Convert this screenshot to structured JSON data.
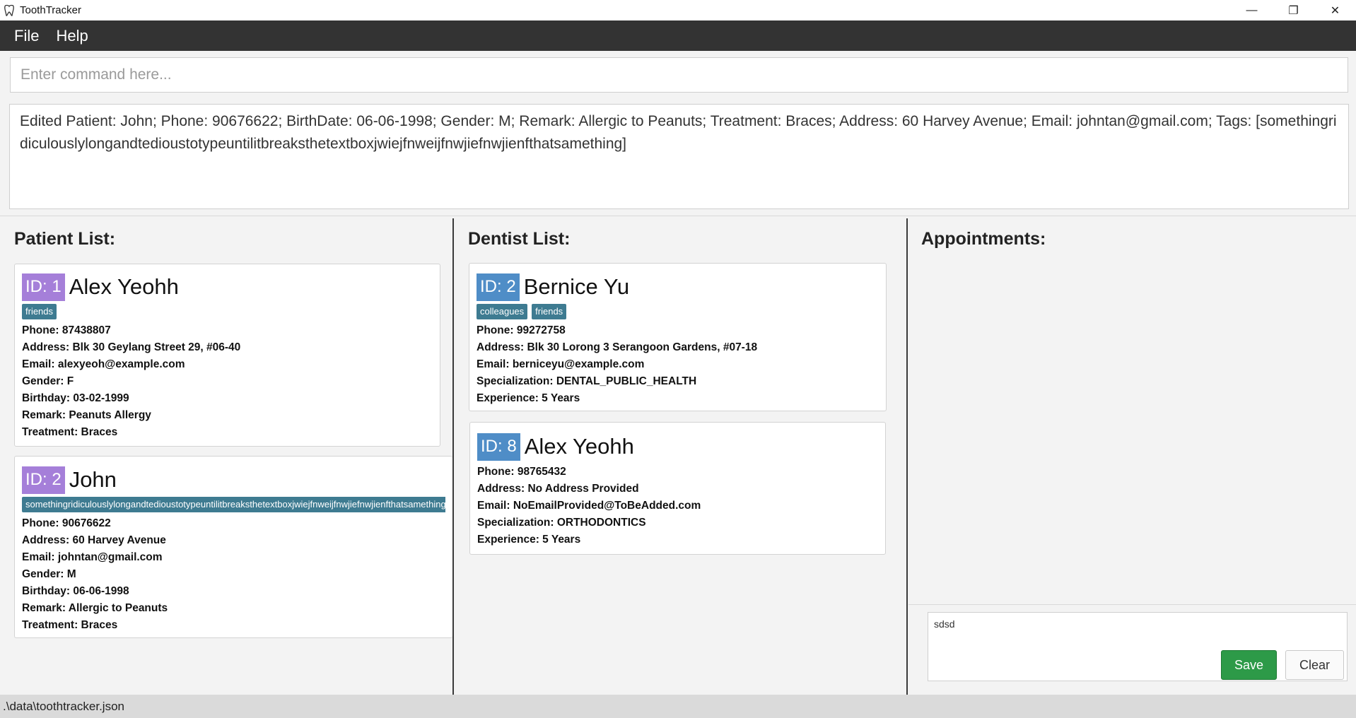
{
  "window": {
    "title": "ToothTracker",
    "minimize": "—",
    "restore": "❐",
    "close": "✕"
  },
  "menu": {
    "file": "File",
    "help": "Help"
  },
  "command": {
    "placeholder": "Enter command here...",
    "value": ""
  },
  "result": {
    "text": "Edited Patient: John; Phone: 90676622; BirthDate: 06-06-1998; Gender: M; Remark: Allergic to Peanuts; Treatment: Braces; Address: 60 Harvey Avenue; Email: johntan@gmail.com; Tags: [somethingridiculouslylongandtedioustotypeuntilitbreaksthetextboxjwiejfnweijfnwjiefnwjienfthatsamething]"
  },
  "patients": {
    "title": "Patient List:",
    "items": [
      {
        "id": "ID: 1",
        "name": "Alex Yeohh",
        "tags": [
          "friends"
        ],
        "phone": "Phone: 87438807",
        "address": "Address: Blk 30 Geylang Street 29, #06-40",
        "email": "Email: alexyeoh@example.com",
        "gender": "Gender: F",
        "birthday": "Birthday: 03-02-1999",
        "remark": "Remark: Peanuts Allergy",
        "treatment": "Treatment: Braces"
      },
      {
        "id": "ID: 2",
        "name": "John",
        "tags": [
          "somethingridiculouslylongandtedioustotypeuntilitbreaksthetextboxjwiejfnweijfnwjiefnwjienfthatsamething"
        ],
        "phone": "Phone: 90676622",
        "address": "Address: 60 Harvey Avenue",
        "email": "Email: johntan@gmail.com",
        "gender": "Gender: M",
        "birthday": "Birthday: 06-06-1998",
        "remark": "Remark: Allergic to Peanuts",
        "treatment": "Treatment: Braces"
      }
    ]
  },
  "dentists": {
    "title": "Dentist List:",
    "items": [
      {
        "id": "ID: 2",
        "name": "Bernice Yu",
        "tags": [
          "colleagues",
          "friends"
        ],
        "phone": "Phone: 99272758",
        "address": "Address: Blk 30 Lorong 3 Serangoon Gardens, #07-18",
        "email": "Email: berniceyu@example.com",
        "specialization": "Specialization: DENTAL_PUBLIC_HEALTH",
        "experience": "Experience: 5 Years"
      },
      {
        "id": "ID: 8",
        "name": "Alex Yeohh",
        "tags": [],
        "phone": "Phone: 98765432",
        "address": "Address: No Address Provided",
        "email": "Email: NoEmailProvided@ToBeAdded.com",
        "specialization": "Specialization: ORTHODONTICS",
        "experience": "Experience: 5 Years"
      }
    ]
  },
  "appointments": {
    "title": "Appointments:",
    "note_value": "sdsd",
    "save_label": "Save",
    "clear_label": "Clear"
  },
  "status": {
    "path": ".\\data\\toothtracker.json"
  },
  "colors": {
    "menubar": "#333333",
    "patient_id_badge": "#a57fd9",
    "dentist_id_badge": "#4f8dc7",
    "tag": "#3e7b91",
    "save_button": "#2d9a48"
  }
}
